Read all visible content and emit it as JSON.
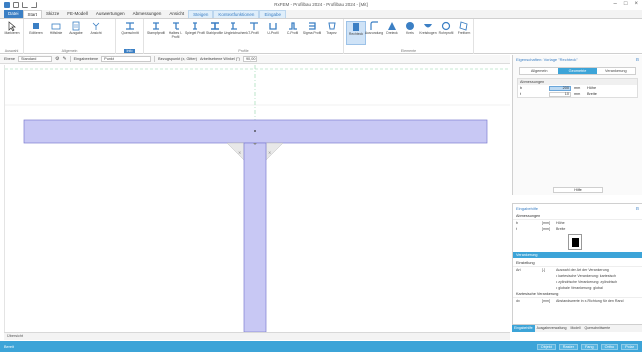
{
  "window": {
    "title": "RxFEM - Profilbau 2024 - Profilbau 2024 - [Mit]",
    "controls": [
      "–",
      "□",
      "×"
    ]
  },
  "ribbon_tabs": [
    {
      "label": "Datei",
      "kind": "file"
    },
    {
      "label": "Start",
      "kind": "active"
    },
    {
      "label": "Skizze",
      "kind": "normal"
    },
    {
      "label": "FE-Modell",
      "kind": "normal"
    },
    {
      "label": "Auswertungen",
      "kind": "normal"
    },
    {
      "label": "Abmessungen",
      "kind": "normal"
    },
    {
      "label": "Ansicht",
      "kind": "normal"
    },
    {
      "label": "Steigen",
      "kind": "ctx"
    },
    {
      "label": "Kontextfunktionen",
      "kind": "ctx"
    },
    {
      "label": "Eingabe",
      "kind": "ctx"
    }
  ],
  "ribbon_groups": [
    {
      "label": "Auswahl",
      "highlight": false
    },
    {
      "label": "Allgemein",
      "highlight": false
    },
    {
      "label": "Info",
      "highlight": true
    },
    {
      "label": "Profile",
      "highlight": false
    },
    {
      "label": "Elemente",
      "highlight": false
    }
  ],
  "ribbon_buttons": [
    "Markieren",
    "Editieren",
    "Hilfslinie",
    "Ausgabe",
    "Ansicht",
    "Datei",
    "Querschnitt",
    "Stampfprofil",
    "Halbes I-Profil",
    "Spiegel Profil",
    "Stahlprofile",
    "Ungleichschenk.",
    "T-Profil",
    "U-Profil",
    "C-Profil",
    "Sigma Profil",
    "Trapez",
    "Rechteck",
    "Ausrundung",
    "Dreieck",
    "Kreis",
    "Kreisbogen",
    "Rohrprofil",
    "Freiform"
  ],
  "toolbar": {
    "layer_label": "Ebene",
    "layer_value": "Standard",
    "drawing_label": "Eingabeebene",
    "drawing_value": "Punkt",
    "snap_label": "Bezugspunkt (x, Gitter)",
    "angle_label": "Arbeitsebene Winkel (°)",
    "angle_value": "90,00"
  },
  "canvas_footer": "Übersicht",
  "statusbar": {
    "left": "Bereit",
    "buttons": [
      "Objekt",
      "Raster",
      "Fang",
      "Ortho",
      "Polar"
    ]
  },
  "properties": {
    "title": "Eigenschaften: Vorlage \"Rechteck\"",
    "tabs": [
      "Allgemein",
      "Geometrie",
      "Verankerung"
    ],
    "active_tab": "Geometrie",
    "section": "Abmessungen",
    "rows": [
      {
        "key": "b",
        "value": "200",
        "unit": "mm",
        "desc": "Höhe"
      },
      {
        "key": "t",
        "value": "10",
        "unit": "mm",
        "desc": "Breite"
      }
    ],
    "footer_button": "Hilfe"
  },
  "help": {
    "title": "Eingabehilfe",
    "section": "Abmessungen",
    "lines": [
      {
        "c1": "b",
        "c2": "[mm]",
        "c3": "Höhe"
      },
      {
        "c1": "t",
        "c2": "[mm]",
        "c3": "Breite"
      }
    ],
    "bluebar": "Verankerung",
    "sub1": "Einstellung",
    "lines2": [
      {
        "c1": "Art",
        "c2": "[-]",
        "c3": "Auswahl der Art der Verankerung"
      },
      {
        "c1": "",
        "c2": "",
        "c3": "• kartesische Verankerung: kartesisch"
      },
      {
        "c1": "",
        "c2": "",
        "c3": "• zylindrische Verankerung: zylindrisch"
      },
      {
        "c1": "",
        "c2": "",
        "c3": "• globale Verankerung: global"
      }
    ],
    "sub2": "Kartesische Verankerung",
    "lines3": [
      {
        "c1": "dx",
        "c2": "[mm]",
        "c3": "Abstandswerte in x-Richtung für den Rand"
      }
    ],
    "tabs": [
      "Eingabehilfe",
      "Ausgabeverwaltung",
      "Modell",
      "Querschnittwerte"
    ],
    "active_tab": "Eingabehilfe"
  },
  "colors": {
    "accent": "#3ca4d8",
    "ribbon_blue": "#3b7fc4",
    "section_fill": "#c8c8f4",
    "section_stroke": "#7d7dd1",
    "guide_green": "#8fd6a8"
  }
}
